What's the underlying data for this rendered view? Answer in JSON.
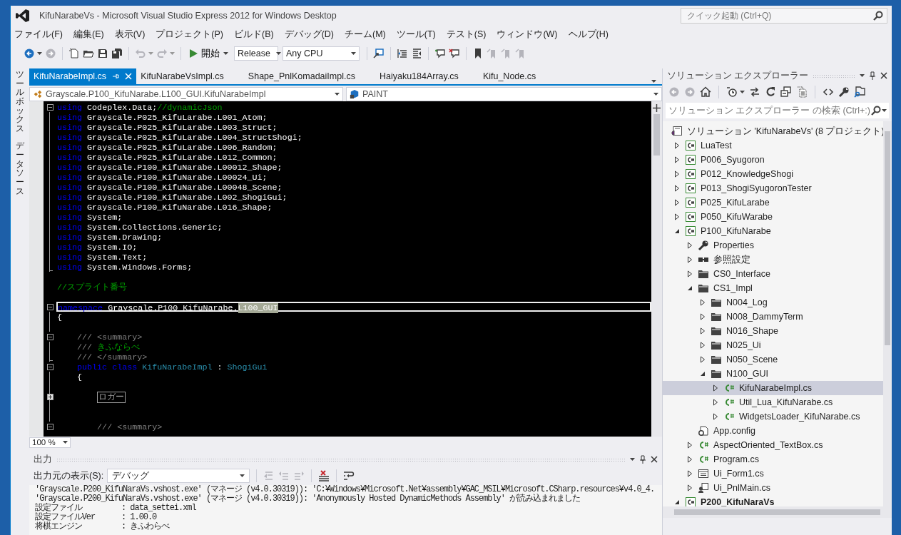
{
  "window": {
    "title": "KifuNarabeVs - Microsoft Visual Studio Express 2012 for Windows Desktop"
  },
  "quick_launch": {
    "placeholder": "クイック起動 (Ctrl+Q)"
  },
  "menu": [
    "ファイル(F)",
    "編集(E)",
    "表示(V)",
    "プロジェクト(P)",
    "ビルド(B)",
    "デバッグ(D)",
    "チーム(M)",
    "ツール(T)",
    "テスト(S)",
    "ウィンドウ(W)",
    "ヘルプ(H)"
  ],
  "toolbar": [
    {
      "kind": "back",
      "disabled": false
    },
    {
      "kind": "forward",
      "disabled": true
    },
    {
      "kind": "separator"
    },
    {
      "kind": "new-item",
      "disabled": false
    },
    {
      "kind": "open",
      "disabled": false
    },
    {
      "kind": "save",
      "disabled": false
    },
    {
      "kind": "save-all",
      "disabled": false
    },
    {
      "kind": "separator"
    },
    {
      "kind": "undo",
      "disabled": true
    },
    {
      "kind": "redo",
      "disabled": true
    },
    {
      "kind": "separator"
    },
    {
      "kind": "start",
      "label": "開始"
    },
    {
      "kind": "combo",
      "value": "Release"
    },
    {
      "kind": "combo",
      "value": "Any CPU"
    },
    {
      "kind": "separator"
    },
    {
      "kind": "attach",
      "disabled": false
    },
    {
      "kind": "separator"
    },
    {
      "kind": "indent",
      "disabled": false
    },
    {
      "kind": "outdent",
      "disabled": false
    },
    {
      "kind": "separator"
    },
    {
      "kind": "comment",
      "disabled": false
    },
    {
      "kind": "uncomment",
      "disabled": false
    },
    {
      "kind": "separator"
    },
    {
      "kind": "bookmark",
      "disabled": false
    },
    {
      "kind": "bookmark-prev",
      "disabled": true
    },
    {
      "kind": "bookmark-next",
      "disabled": true
    },
    {
      "kind": "bookmark-clear",
      "disabled": true
    }
  ],
  "side_tabs": [
    {
      "label": "ツールボックス"
    },
    {
      "label": "データソース"
    }
  ],
  "editor": {
    "tabs": [
      {
        "label": "KifuNarabeImpl.cs",
        "selected": true
      },
      {
        "label": "KifuNarabeVsImpl.cs",
        "selected": false
      },
      {
        "label": "Shape_PnlKomadaiImpl.cs",
        "selected": false
      },
      {
        "label": "Haiyaku184Array.cs",
        "selected": false
      },
      {
        "label": "Kifu_Node.cs",
        "selected": false
      }
    ],
    "nav": {
      "scope": "Grayscale.P100_KifuNarabe.L100_GUI.KifuNarabeImpl",
      "member": "PAINT"
    },
    "lines": [
      {
        "kind": "fold-start",
        "current": false,
        "parts": [
          {
            "kind": "keyword",
            "text": "using"
          },
          {
            "kind": "plain",
            "text": " Codeplex.Data;"
          },
          {
            "kind": "comment",
            "text": "//dynamicJson"
          }
        ]
      },
      {
        "kind": "fold-body",
        "current": false,
        "parts": [
          {
            "kind": "keyword",
            "text": "using"
          },
          {
            "kind": "plain",
            "text": " Grayscale.P025_KifuLarabe.L001_Atom;"
          }
        ]
      },
      {
        "kind": "fold-body",
        "current": false,
        "parts": [
          {
            "kind": "keyword",
            "text": "using"
          },
          {
            "kind": "plain",
            "text": " Grayscale.P025_KifuLarabe.L003_Struct;"
          }
        ]
      },
      {
        "kind": "fold-body",
        "current": false,
        "parts": [
          {
            "kind": "keyword",
            "text": "using"
          },
          {
            "kind": "plain",
            "text": " Grayscale.P025_KifuLarabe.L004_StructShogi;"
          }
        ]
      },
      {
        "kind": "fold-body",
        "current": false,
        "parts": [
          {
            "kind": "keyword",
            "text": "using"
          },
          {
            "kind": "plain",
            "text": " Grayscale.P025_KifuLarabe.L006_Random;"
          }
        ]
      },
      {
        "kind": "fold-body",
        "current": false,
        "parts": [
          {
            "kind": "keyword",
            "text": "using"
          },
          {
            "kind": "plain",
            "text": " Grayscale.P025_KifuLarabe.L012_Common;"
          }
        ]
      },
      {
        "kind": "fold-body",
        "current": false,
        "parts": [
          {
            "kind": "keyword",
            "text": "using"
          },
          {
            "kind": "plain",
            "text": " Grayscale.P100_KifuNarabe.L00012_Shape;"
          }
        ]
      },
      {
        "kind": "fold-body",
        "current": false,
        "parts": [
          {
            "kind": "keyword",
            "text": "using"
          },
          {
            "kind": "plain",
            "text": " Grayscale.P100_KifuNarabe.L00024_Ui;"
          }
        ]
      },
      {
        "kind": "fold-body",
        "current": false,
        "parts": [
          {
            "kind": "keyword",
            "text": "using"
          },
          {
            "kind": "plain",
            "text": " Grayscale.P100_KifuNarabe.L00048_Scene;"
          }
        ]
      },
      {
        "kind": "fold-body",
        "current": false,
        "parts": [
          {
            "kind": "keyword",
            "text": "using"
          },
          {
            "kind": "plain",
            "text": " Grayscale.P100_KifuNarabe.L002_ShogiGui;"
          }
        ]
      },
      {
        "kind": "fold-body",
        "current": false,
        "parts": [
          {
            "kind": "keyword",
            "text": "using"
          },
          {
            "kind": "plain",
            "text": " Grayscale.P100_KifuNarabe.L016_Shape;"
          }
        ]
      },
      {
        "kind": "fold-body",
        "current": false,
        "parts": [
          {
            "kind": "keyword",
            "text": "using"
          },
          {
            "kind": "plain",
            "text": " System;"
          }
        ]
      },
      {
        "kind": "fold-body",
        "current": false,
        "parts": [
          {
            "kind": "keyword",
            "text": "using"
          },
          {
            "kind": "plain",
            "text": " System.Collections.Generic;"
          }
        ]
      },
      {
        "kind": "fold-body",
        "current": false,
        "parts": [
          {
            "kind": "keyword",
            "text": "using"
          },
          {
            "kind": "plain",
            "text": " System.Drawing;"
          }
        ]
      },
      {
        "kind": "fold-body",
        "current": false,
        "parts": [
          {
            "kind": "keyword",
            "text": "using"
          },
          {
            "kind": "plain",
            "text": " System.IO;"
          }
        ]
      },
      {
        "kind": "fold-body",
        "current": false,
        "parts": [
          {
            "kind": "keyword",
            "text": "using"
          },
          {
            "kind": "plain",
            "text": " System.Text;"
          }
        ]
      },
      {
        "kind": "fold-end",
        "current": false,
        "parts": [
          {
            "kind": "keyword",
            "text": "using"
          },
          {
            "kind": "plain",
            "text": " System.Windows.Forms;"
          }
        ]
      },
      {
        "kind": "plain",
        "current": false
      },
      {
        "kind": "plain",
        "current": false,
        "parts": [
          {
            "kind": "comment",
            "text": "//スプライト番号"
          }
        ]
      },
      {
        "kind": "plain",
        "current": false
      },
      {
        "kind": "fold-start",
        "current": true,
        "parts": [
          {
            "kind": "keyword",
            "text": "namespace"
          },
          {
            "kind": "plain",
            "text": " Grayscale.P100_KifuNarabe."
          },
          {
            "kind": "highlight",
            "text": "L100_GUI"
          }
        ]
      },
      {
        "kind": "fold-body",
        "current": false,
        "parts": [
          {
            "kind": "plain",
            "text": "{"
          }
        ]
      },
      {
        "kind": "fold-body",
        "current": false
      },
      {
        "kind": "fold-start",
        "current": false,
        "parts": [
          {
            "kind": "doc",
            "text": "    /// <summary>"
          }
        ]
      },
      {
        "kind": "fold-body",
        "current": false,
        "parts": [
          {
            "kind": "doc",
            "text": "    /// "
          },
          {
            "kind": "comment",
            "text": "きふならべ"
          }
        ]
      },
      {
        "kind": "fold-end",
        "current": false,
        "parts": [
          {
            "kind": "doc",
            "text": "    /// </summary>"
          }
        ]
      },
      {
        "kind": "fold-start",
        "current": false,
        "parts": [
          {
            "kind": "keyword",
            "text": "    public class "
          },
          {
            "kind": "type",
            "text": "KifuNarabeImpl"
          },
          {
            "kind": "plain",
            "text": " : "
          },
          {
            "kind": "type",
            "text": "ShogiGui"
          }
        ]
      },
      {
        "kind": "fold-body",
        "current": false,
        "parts": [
          {
            "kind": "plain",
            "text": "    {"
          }
        ]
      },
      {
        "kind": "fold-body",
        "current": false
      },
      {
        "kind": "collapsed",
        "current": false,
        "parts": [
          {
            "kind": "collapsed",
            "text": "ロガー"
          }
        ]
      },
      {
        "kind": "fold-body",
        "current": false
      },
      {
        "kind": "fold-body",
        "current": false
      },
      {
        "kind": "fold-start",
        "current": false,
        "parts": [
          {
            "kind": "doc",
            "text": "        /// <summary>"
          }
        ]
      }
    ],
    "zoom": "100 %"
  },
  "output": {
    "title": "出力",
    "source_label": "出力元の表示(S):",
    "source": "デバッグ",
    "tools": [
      {
        "kind": "goto",
        "disabled": true
      },
      {
        "kind": "prev",
        "disabled": true
      },
      {
        "kind": "next",
        "disabled": true
      },
      {
        "kind": "clear",
        "disabled": false
      },
      {
        "kind": "wrap",
        "disabled": false
      }
    ],
    "lines": [
      "'Grayscale.P200_KifuNaraVs.vshost.exe' (マネージ (v4.0.30319)): 'C:¥Windows¥Microsoft.Net¥assembly¥GAC_MSIL¥Microsoft.CSharp.resources¥v4.0_4.",
      "'Grayscale.P200_KifuNaraVs.vshost.exe' (マネージ (v4.0.30319)): 'Anonymously Hosted DynamicMethods Assembly' が読み込まれました",
      "設定ファイル         : data_settei.xml",
      "設定ファイルVer      : 1.00.0",
      "将棋エンジン         : きふわらべ"
    ]
  },
  "solution_explorer": {
    "title": "ソリューション エクスプローラー",
    "search": {
      "placeholder": "ソリューション エクスプローラー の検索 (Ctrl+:)"
    },
    "tools": [
      {
        "kind": "back",
        "disabled": true
      },
      {
        "kind": "forward",
        "disabled": true
      },
      {
        "kind": "home",
        "disabled": false
      },
      {
        "kind": "separator"
      },
      {
        "kind": "pending",
        "disabled": false
      },
      {
        "kind": "sync",
        "disabled": false
      },
      {
        "kind": "refresh",
        "disabled": false
      },
      {
        "kind": "collapse",
        "disabled": false
      },
      {
        "kind": "show-all",
        "disabled": false
      },
      {
        "kind": "separator"
      },
      {
        "kind": "code",
        "disabled": false
      },
      {
        "kind": "properties",
        "disabled": false
      },
      {
        "kind": "preview",
        "disabled": false
      }
    ],
    "tree": [
      {
        "label": "ソリューション 'KifuNarabeVs' (8 プロジェクト)",
        "kind": "solution",
        "selected": false,
        "children": [
          {
            "label": "LuaTest",
            "kind": "project",
            "expanded": false,
            "selected": false,
            "startup": false
          },
          {
            "label": "P006_Syugoron",
            "kind": "project",
            "expanded": false,
            "selected": false,
            "startup": false
          },
          {
            "label": "P012_KnowledgeShogi",
            "kind": "project",
            "expanded": false,
            "selected": false,
            "startup": false
          },
          {
            "label": "P013_ShogiSyugoronTester",
            "kind": "project",
            "expanded": false,
            "selected": false,
            "startup": false
          },
          {
            "label": "P025_KifuLarabe",
            "kind": "project",
            "expanded": false,
            "selected": false,
            "startup": false
          },
          {
            "label": "P050_KifuWarabe",
            "kind": "project",
            "expanded": false,
            "selected": false,
            "startup": false
          },
          {
            "label": "P100_KifuNarabe",
            "kind": "project",
            "expanded": true,
            "selected": false,
            "startup": false,
            "children": [
              {
                "label": "Properties",
                "kind": "properties",
                "expanded": false,
                "selected": false
              },
              {
                "label": "参照設定",
                "kind": "references",
                "expanded": false,
                "selected": false
              },
              {
                "label": "CS0_Interface",
                "kind": "folder",
                "expanded": false,
                "selected": false
              },
              {
                "label": "CS1_Impl",
                "kind": "folder",
                "expanded": true,
                "selected": false,
                "children": [
                  {
                    "label": "N004_Log",
                    "kind": "folder",
                    "expanded": false,
                    "selected": false
                  },
                  {
                    "label": "N008_DammyTerm",
                    "kind": "folder",
                    "expanded": false,
                    "selected": false
                  },
                  {
                    "label": "N016_Shape",
                    "kind": "folder",
                    "expanded": false,
                    "selected": false
                  },
                  {
                    "label": "N025_Ui",
                    "kind": "folder",
                    "expanded": false,
                    "selected": false
                  },
                  {
                    "label": "N050_Scene",
                    "kind": "folder",
                    "expanded": false,
                    "selected": false
                  },
                  {
                    "label": "N100_GUI",
                    "kind": "folder",
                    "expanded": true,
                    "selected": false,
                    "children": [
                      {
                        "label": "KifuNarabeImpl.cs",
                        "kind": "code-file",
                        "expanded": false,
                        "selected": true
                      },
                      {
                        "label": "Util_Lua_KifuNarabe.cs",
                        "kind": "code-file",
                        "expanded": false,
                        "selected": false
                      },
                      {
                        "label": "WidgetsLoader_KifuNarabe.cs",
                        "kind": "code-file",
                        "expanded": false,
                        "selected": false
                      }
                    ]
                  }
                ]
              },
              {
                "label": "App.config",
                "kind": "config",
                "selected": false
              },
              {
                "label": "AspectOriented_TextBox.cs",
                "kind": "code-file",
                "expanded": false,
                "selected": false
              },
              {
                "label": "Program.cs",
                "kind": "code-file",
                "expanded": false,
                "selected": false
              },
              {
                "label": "Ui_Form1.cs",
                "kind": "form",
                "expanded": false,
                "selected": false
              },
              {
                "label": "Ui_PnlMain.cs",
                "kind": "user-control",
                "expanded": false,
                "selected": false
              }
            ]
          },
          {
            "label": "P200_KifuNaraVs",
            "kind": "project",
            "expanded": true,
            "selected": false,
            "startup": true
          }
        ]
      }
    ]
  }
}
